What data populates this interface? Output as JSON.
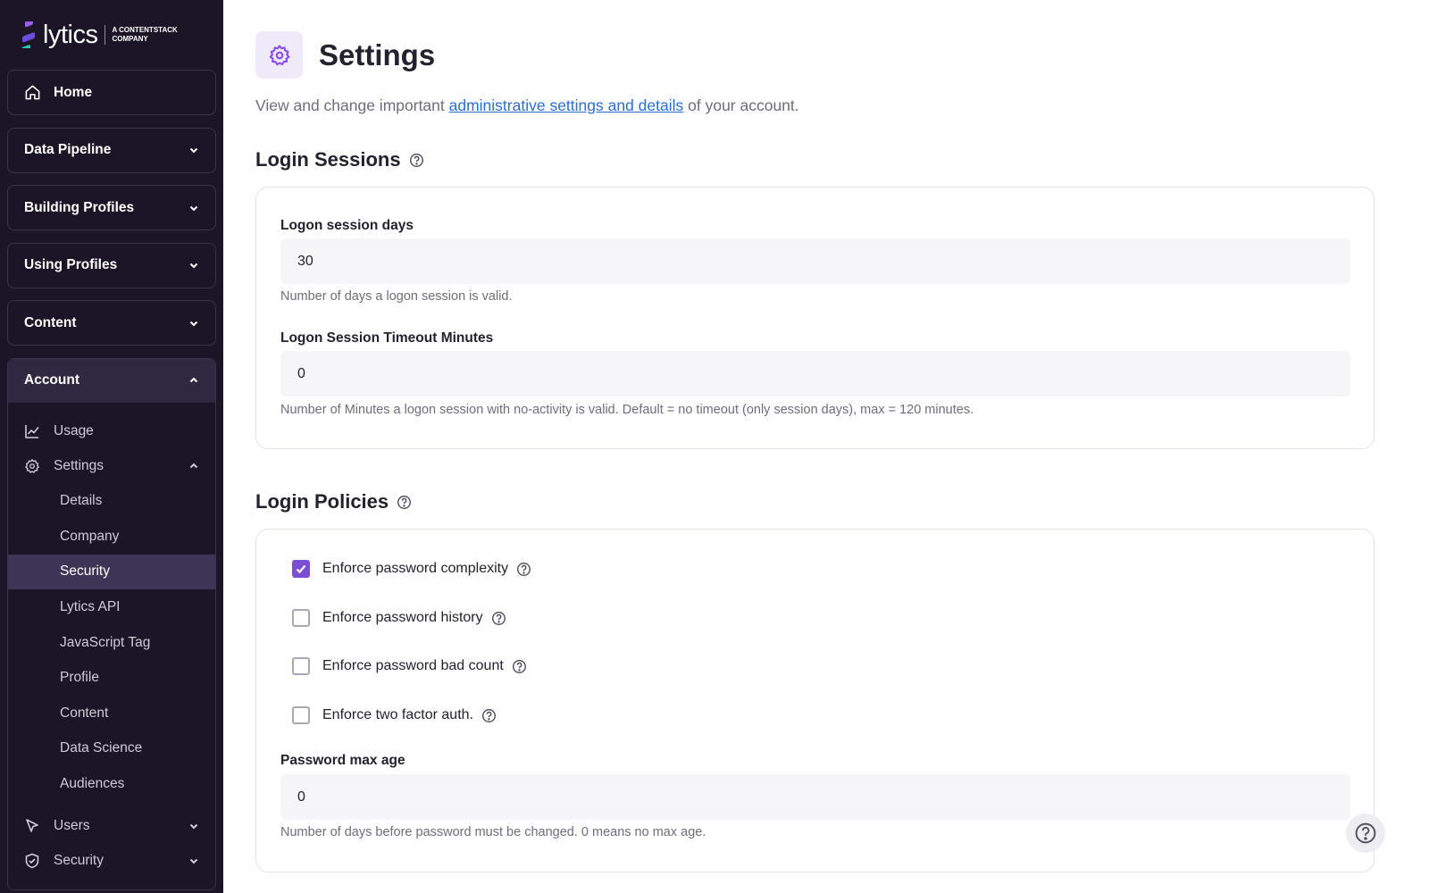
{
  "brand": {
    "name": "lytics",
    "tagline": "A CONTENTSTACK COMPANY"
  },
  "sidebar": {
    "top_items": [
      {
        "label": "Home",
        "icon": "home-icon"
      },
      {
        "label": "Data Pipeline",
        "icon": "chevron-down-icon"
      },
      {
        "label": "Building Profiles",
        "icon": "chevron-down-icon"
      },
      {
        "label": "Using Profiles",
        "icon": "chevron-down-icon"
      },
      {
        "label": "Content",
        "icon": "chevron-down-icon"
      }
    ],
    "account": {
      "label": "Account",
      "usage": "Usage",
      "settings": "Settings",
      "settings_items": [
        "Details",
        "Company",
        "Security",
        "Lytics API",
        "JavaScript Tag",
        "Profile",
        "Content",
        "Data Science",
        "Audiences"
      ],
      "active_item": "Security",
      "users": "Users",
      "security": "Security"
    }
  },
  "main": {
    "title": "Settings",
    "desc_before": "View and change important ",
    "desc_link": "administrative settings and details",
    "desc_after": " of your account.",
    "login_sessions": {
      "title": "Login Sessions",
      "session_days_label": "Logon session days",
      "session_days_value": "30",
      "session_days_help": "Number of days a logon session is valid.",
      "timeout_label": "Logon Session Timeout Minutes",
      "timeout_value": "0",
      "timeout_help": "Number of Minutes a logon session with no-activity is valid. Default = no timeout (only session days), max = 120 minutes."
    },
    "login_policies": {
      "title": "Login Policies",
      "checks": [
        {
          "label": "Enforce password complexity",
          "checked": true
        },
        {
          "label": "Enforce password history",
          "checked": false
        },
        {
          "label": "Enforce password bad count",
          "checked": false
        },
        {
          "label": "Enforce two factor auth.",
          "checked": false
        }
      ],
      "max_age_label": "Password max age",
      "max_age_value": "0",
      "max_age_help": "Number of days before password must be changed. 0 means no max age."
    }
  },
  "colors": {
    "sidebar_bg": "#1b1527",
    "accent": "#7b4ed6",
    "link": "#2a6fd6"
  }
}
